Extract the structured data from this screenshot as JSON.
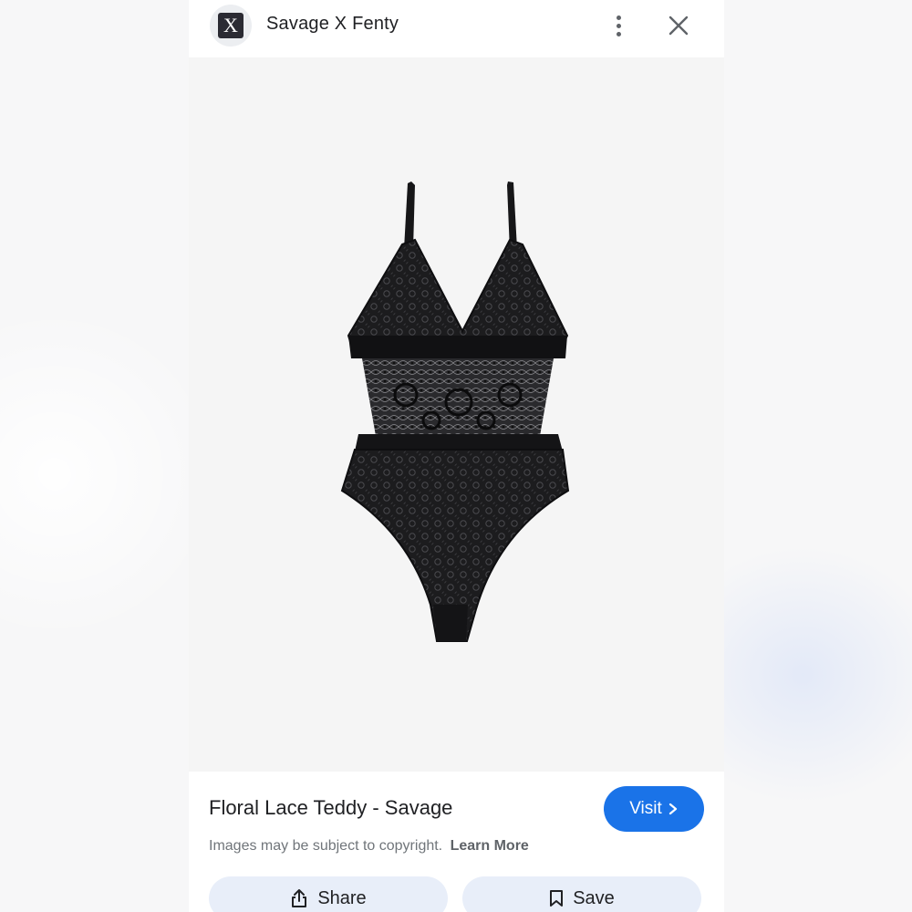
{
  "header": {
    "source_name": "Savage X Fenty",
    "favicon_letter": "X",
    "icons": {
      "more": "more-vert-icon",
      "close": "close-icon"
    }
  },
  "image": {
    "subject": "black lace teddy bodysuit product photo"
  },
  "info": {
    "title": "Floral Lace Teddy - Savage",
    "visit_label": "Visit",
    "copyright_text": "Images may be subject to copyright.",
    "learn_more_label": "Learn More",
    "share_label": "Share",
    "save_label": "Save"
  },
  "colors": {
    "accent": "#1a73e8",
    "action_bg": "#e8eef9",
    "text": "#202124",
    "muted": "#70757a"
  }
}
